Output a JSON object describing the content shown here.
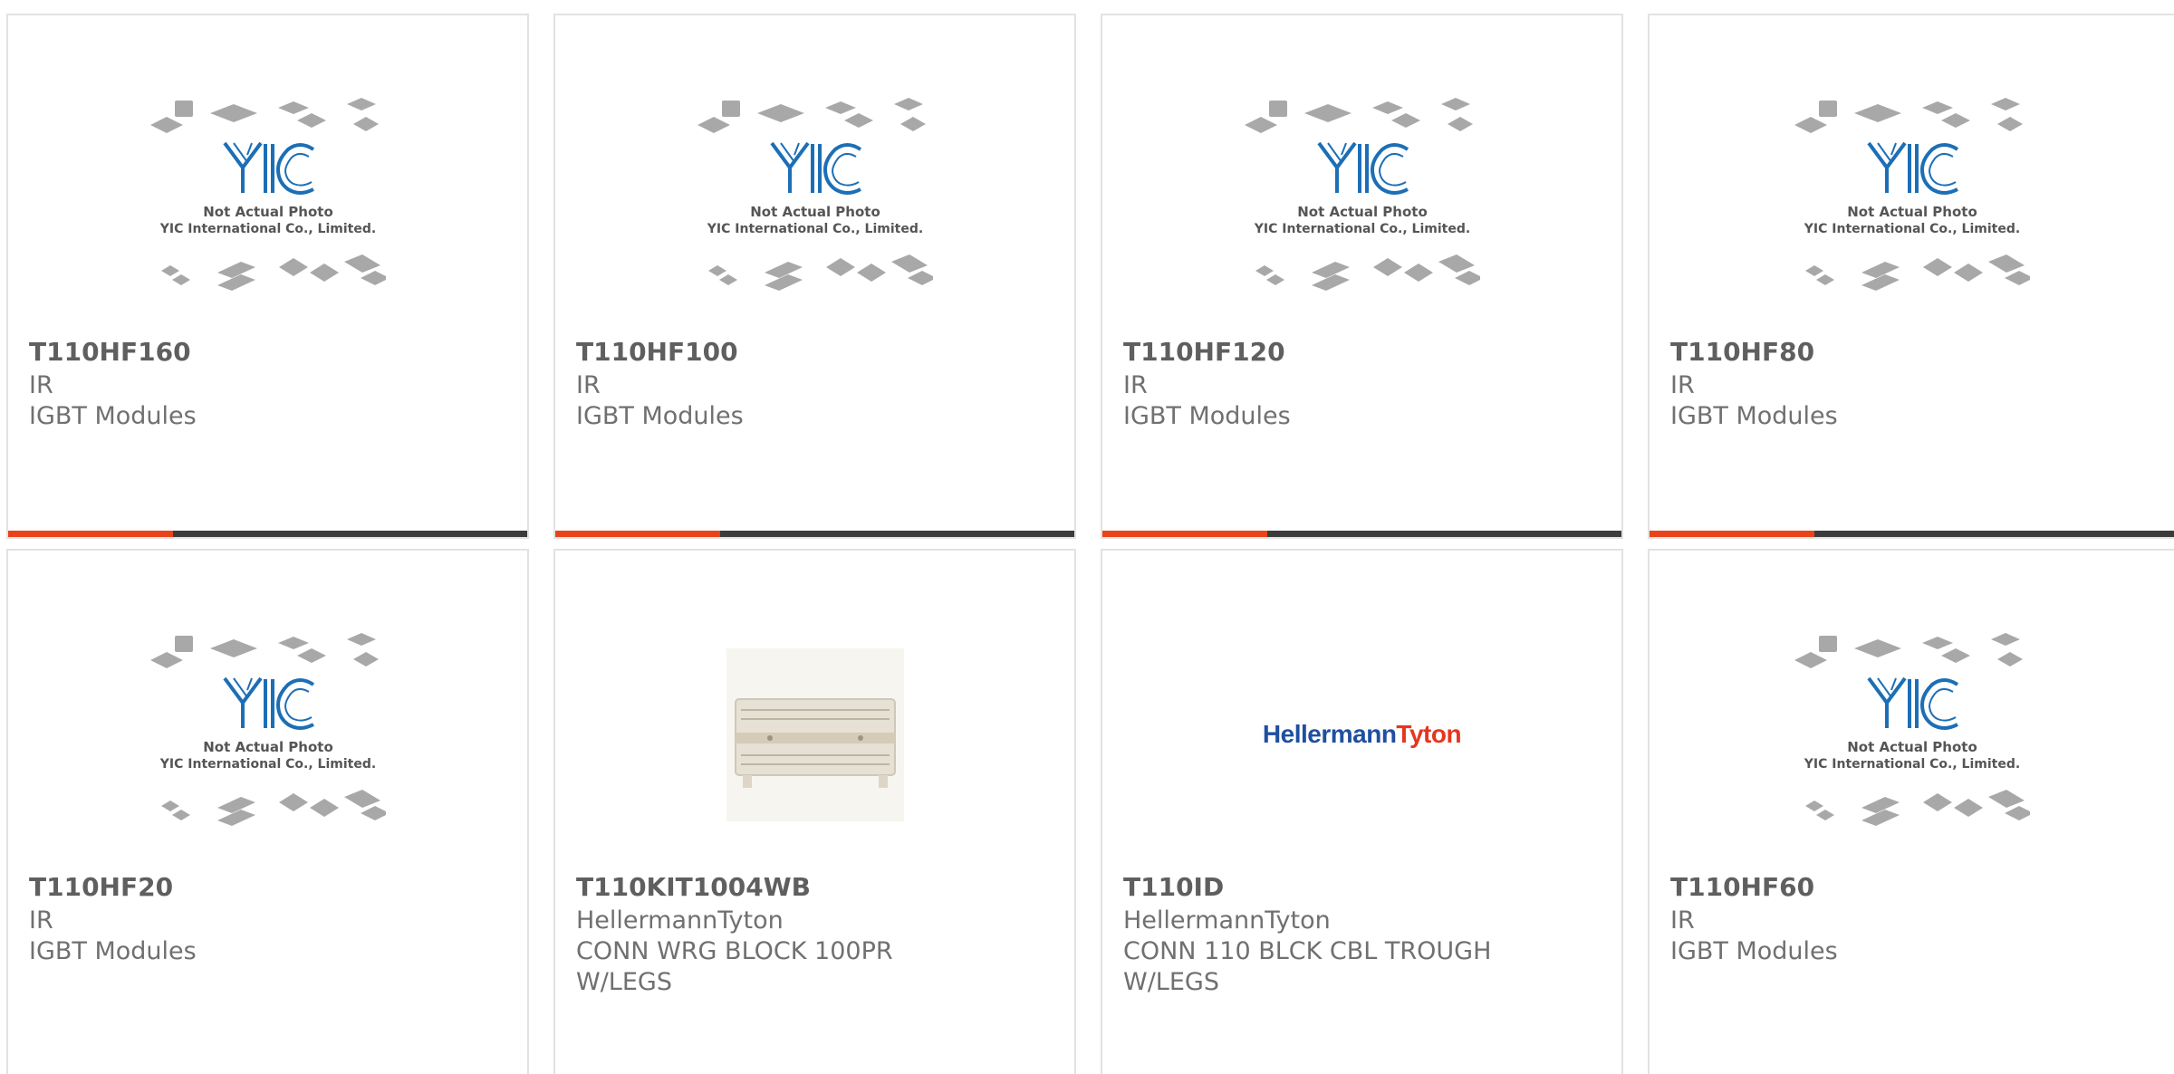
{
  "colors": {
    "accent": "#e8431a",
    "bar": "#3b3b3b",
    "border": "#e2e2e2",
    "logo_blue": "#1c6fb6"
  },
  "placeholder": {
    "caption_line1": "Not Actual Photo",
    "caption_line2": "YIC International Co., Limited.",
    "logo_text": "YIC"
  },
  "products": [
    {
      "part": "T110HF160",
      "manufacturer": "IR",
      "description": "IGBT Modules",
      "image": "yic-placeholder-image"
    },
    {
      "part": "T110HF100",
      "manufacturer": "IR",
      "description": "IGBT Modules",
      "image": "yic-placeholder-image"
    },
    {
      "part": "T110HF120",
      "manufacturer": "IR",
      "description": "IGBT Modules",
      "image": "yic-placeholder-image"
    },
    {
      "part": "T110HF80",
      "manufacturer": "IR",
      "description": "IGBT Modules",
      "image": "yic-placeholder-image"
    },
    {
      "part": "T110HF20",
      "manufacturer": "IR",
      "description": "IGBT Modules",
      "image": "yic-placeholder-image"
    },
    {
      "part": "T110KIT1004WB",
      "manufacturer": "HellermannTyton",
      "description": "CONN WRG BLOCK 100PR W/LEGS",
      "image": "wiring-block-photo"
    },
    {
      "part": "T110ID",
      "manufacturer": "HellermannTyton",
      "description": "CONN 110 BLCK CBL TROUGH W/LEGS",
      "image": "hellermanntyton-logo",
      "logo_part1": "Hellermann",
      "logo_part2": "Tyton"
    },
    {
      "part": "T110HF60",
      "manufacturer": "IR",
      "description": "IGBT Modules",
      "image": "yic-placeholder-image"
    }
  ]
}
